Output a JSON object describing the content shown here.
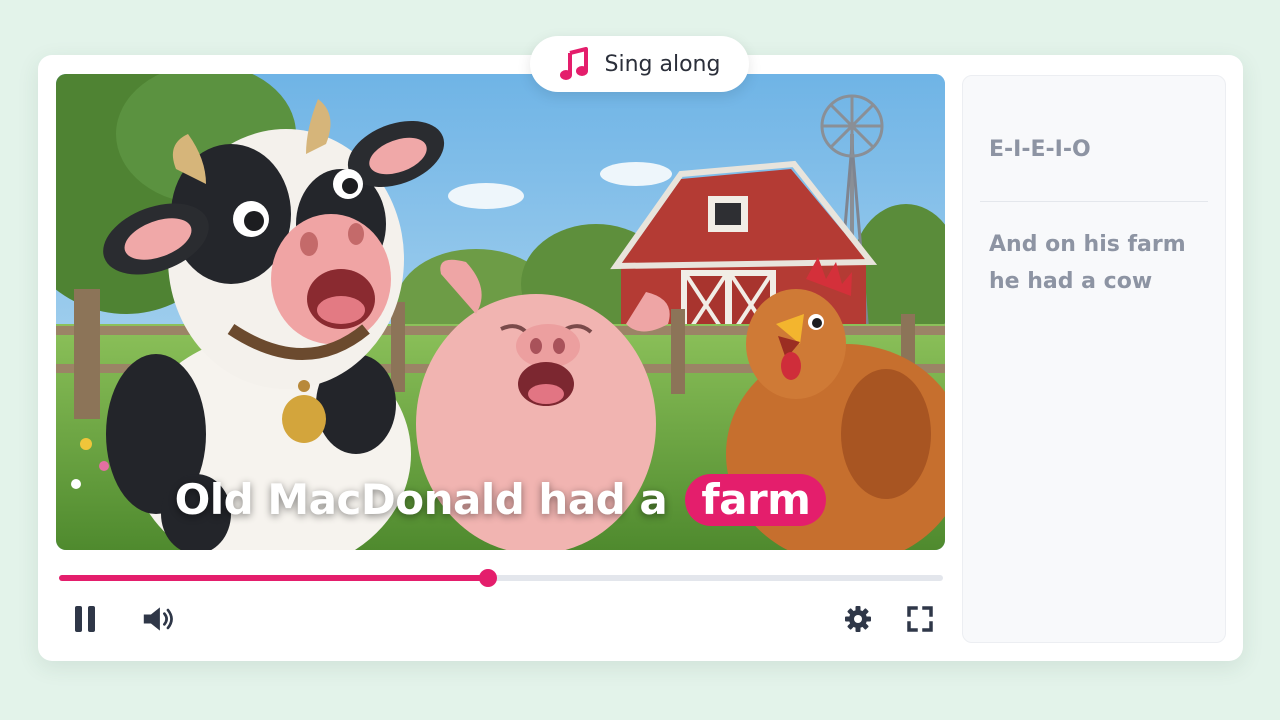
{
  "badge": {
    "icon": "music-note-icon",
    "label": "Sing along"
  },
  "video": {
    "caption_text": "Old MacDonald had a",
    "caption_highlight": "farm"
  },
  "player": {
    "progress": 0.485,
    "accent_color": "#e41e6c",
    "controls": [
      "pause-icon",
      "volume-icon",
      "gear-icon",
      "fullscreen-icon"
    ]
  },
  "lyrics": {
    "previous_line": "E-I-E-I-O",
    "next_line_1": "And on his farm",
    "next_line_2": "he had a cow"
  }
}
